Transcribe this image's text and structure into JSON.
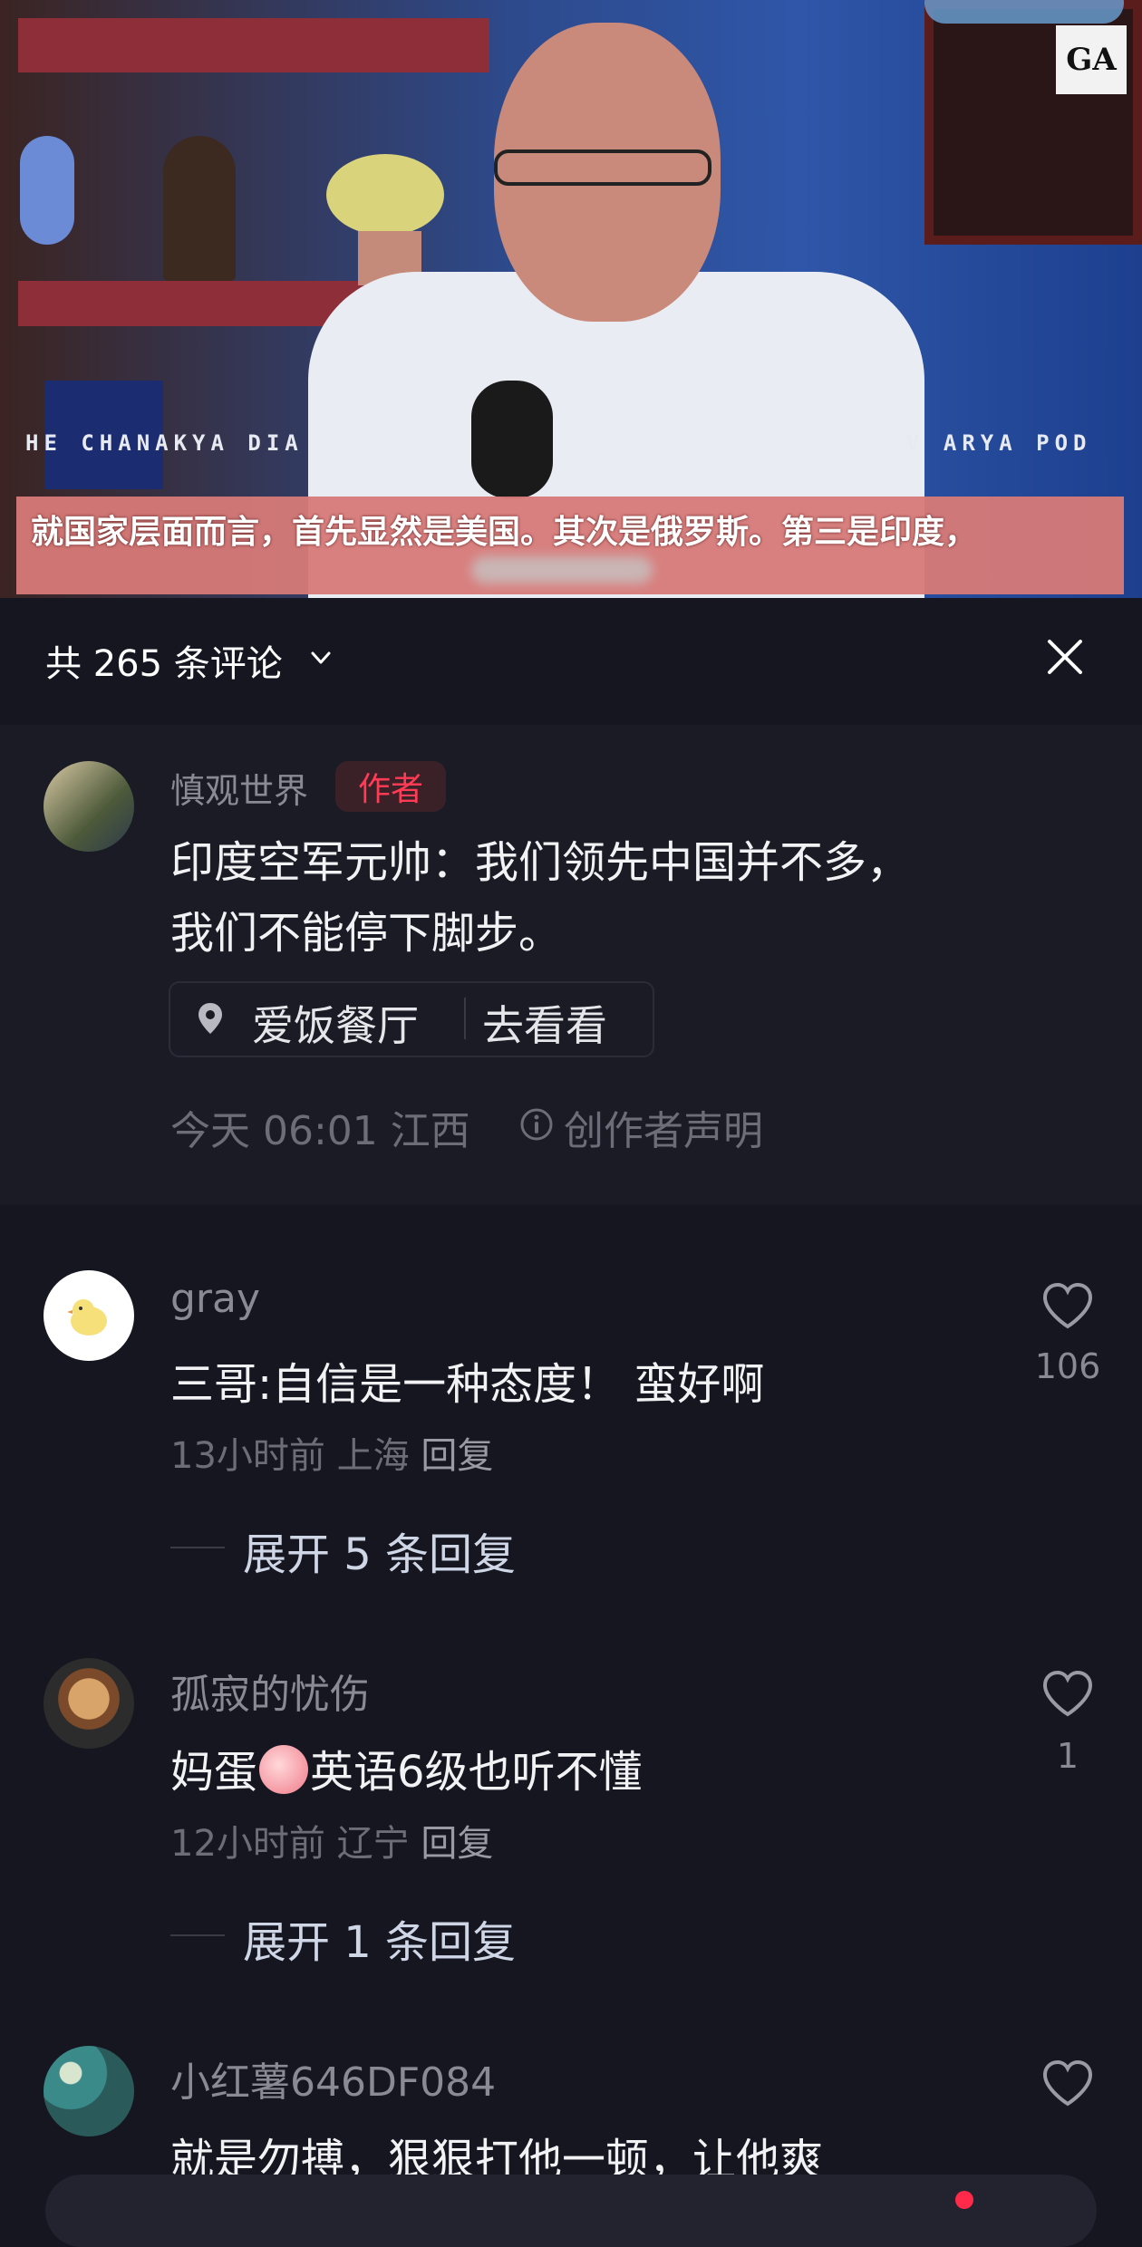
{
  "video": {
    "logo_text": "GA",
    "banner_left": "HE CHANAKYA DIA",
    "banner_right": "V ARYA POD",
    "subtitle": "就国家层面而言，首先显然是美国。其次是俄罗斯。第三是印度，"
  },
  "header": {
    "title": "共 265 条评论",
    "chevron_icon": "chevron-down-icon",
    "close_icon": "close-icon"
  },
  "author_post": {
    "name": "慎观世界",
    "badge": "作者",
    "text_line1": "印度空军元帅：我们领先中国并不多，",
    "text_line2": "我们不能停下脚步。",
    "location_name": "爱饭餐厅",
    "location_action": "去看看",
    "time_place": "今天 06:01 江西",
    "declaration": "创作者声明"
  },
  "comments": [
    {
      "name": "gray",
      "text": "三哥:自信是一种态度！ 蛮好啊",
      "time_place": "13小时前 上海",
      "reply_label": "回复",
      "likes": "106",
      "expand": "展开 5 条回复"
    },
    {
      "name": "孤寂的忧伤",
      "text_before_emoji": "妈蛋",
      "text_after_emoji": "英语6级也听不懂",
      "time_place": "12小时前 辽宁",
      "reply_label": "回复",
      "likes": "1",
      "expand": "展开 1 条回复"
    },
    {
      "name": "小红薯646DF084",
      "text": "就是勿搏，狠狠打他一顿，让他爽"
    }
  ],
  "colors": {
    "background": "#161621",
    "author_badge": "#ff3b55",
    "notification_dot": "#ff2a4a"
  }
}
